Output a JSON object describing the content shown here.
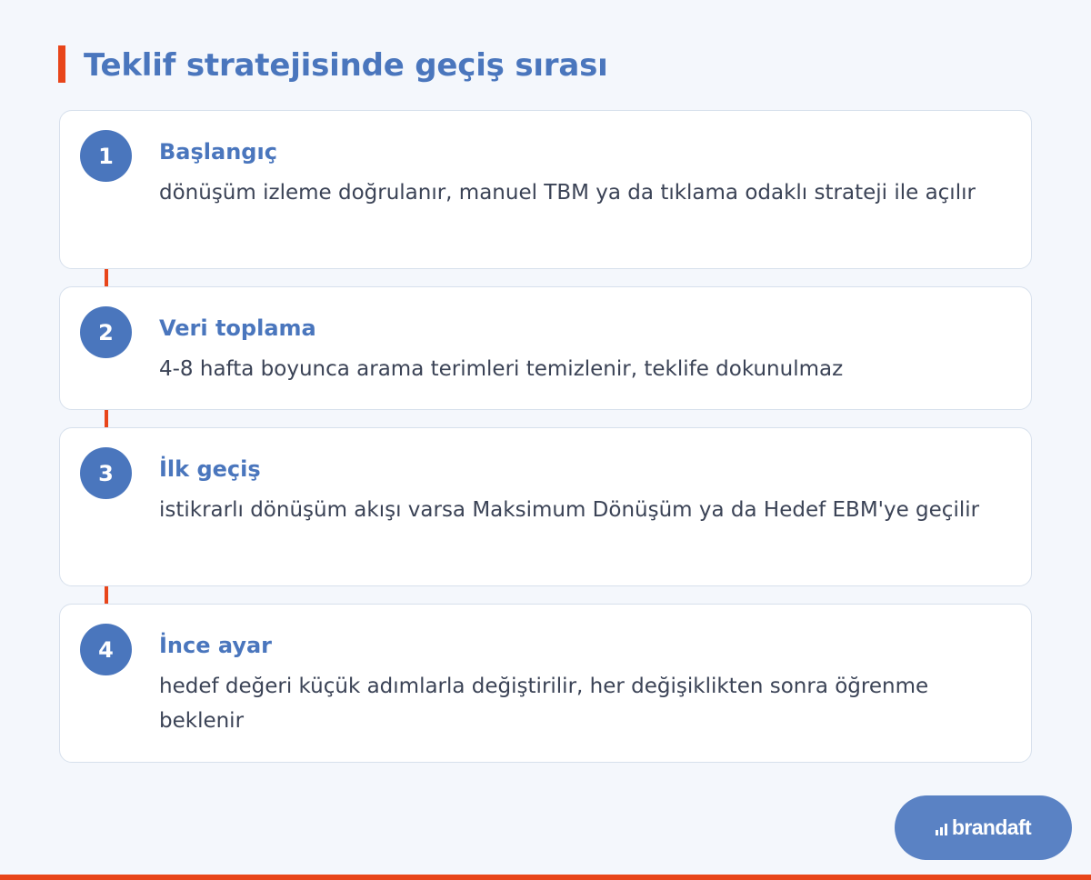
{
  "header": {
    "title": "Teklif stratejisinde geçiş sırası"
  },
  "steps": [
    {
      "number": "1",
      "title": "Başlangıç",
      "description": "dönüşüm izleme doğrulanır, manuel TBM ya da tıklama odaklı strateji ile açılır"
    },
    {
      "number": "2",
      "title": "Veri toplama",
      "description": "4-8 hafta boyunca arama terimleri temizlenir, teklife dokunulmaz"
    },
    {
      "number": "3",
      "title": "İlk geçiş",
      "description": "istikrarlı dönüşüm akışı varsa Maksimum Dönüşüm ya da Hedef EBM'ye geçilir"
    },
    {
      "number": "4",
      "title": "İnce ayar",
      "description": "hedef değeri küçük adımlarla değiştirilir, her değişiklikten sonra öğrenme beklenir"
    }
  ],
  "brand": {
    "name": "brandaft",
    "icon": "bar-chart-icon"
  },
  "colors": {
    "accent": "#e8451a",
    "primary": "#4a76bd",
    "background": "#f4f7fc",
    "card": "#ffffff",
    "text": "#3b4356"
  }
}
